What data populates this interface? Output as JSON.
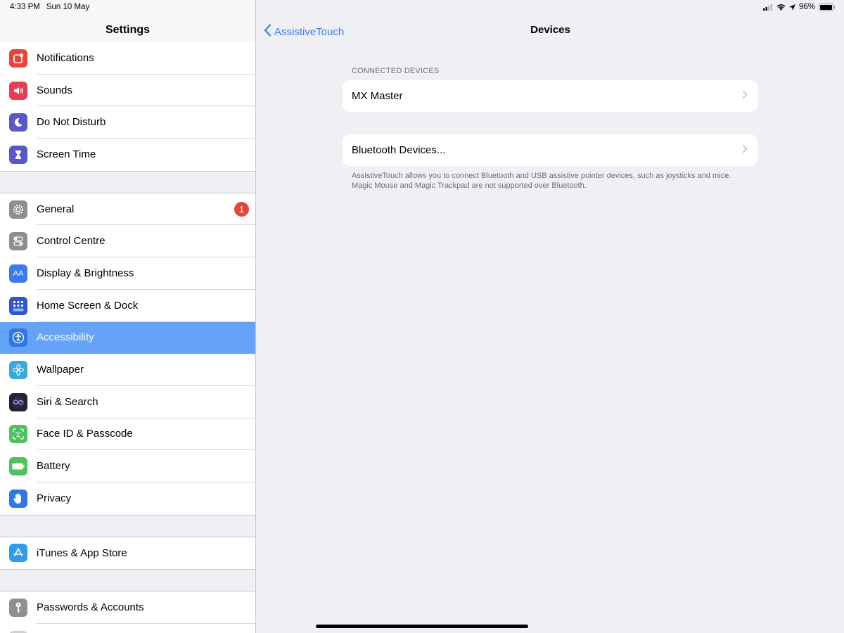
{
  "status_bar": {
    "time": "4:33 PM",
    "date": "Sun 10 May",
    "battery": "96%",
    "icons": [
      "signal-icon",
      "wifi-icon",
      "location-icon",
      "battery-icon"
    ]
  },
  "sidebar": {
    "title": "Settings",
    "groups": [
      [
        {
          "label": "Notifications",
          "icon": "notifications-icon",
          "color": "#e9433c"
        },
        {
          "label": "Sounds",
          "icon": "sounds-icon",
          "color": "#e73d54"
        },
        {
          "label": "Do Not Disturb",
          "icon": "moon-icon",
          "color": "#5a57c9"
        },
        {
          "label": "Screen Time",
          "icon": "hourglass-icon",
          "color": "#5a57c9"
        }
      ],
      [
        {
          "label": "General",
          "icon": "gear-icon",
          "color": "#8e8e93",
          "badge": "1"
        },
        {
          "label": "Control Centre",
          "icon": "toggles-icon",
          "color": "#8e8e93"
        },
        {
          "label": "Display & Brightness",
          "icon": "display-icon",
          "color": "#3a7cf0"
        },
        {
          "label": "Home Screen & Dock",
          "icon": "home-grid-icon",
          "color": "#2f56d0"
        },
        {
          "label": "Accessibility",
          "icon": "accessibility-icon",
          "color": "#2f77e8",
          "selected": true
        },
        {
          "label": "Wallpaper",
          "icon": "flower-icon",
          "color": "#37aadc"
        },
        {
          "label": "Siri & Search",
          "icon": "siri-icon",
          "color": "#222233"
        },
        {
          "label": "Face ID & Passcode",
          "icon": "faceid-icon",
          "color": "#4cc35c"
        },
        {
          "label": "Battery",
          "icon": "battery-icon",
          "color": "#4cc35c"
        },
        {
          "label": "Privacy",
          "icon": "hand-icon",
          "color": "#2f77e8"
        }
      ],
      [
        {
          "label": "iTunes & App Store",
          "icon": "appstore-icon",
          "color": "#2f9cf1"
        }
      ],
      [
        {
          "label": "Passwords & Accounts",
          "icon": "key-icon",
          "color": "#8e8e93"
        },
        {
          "label": "",
          "icon": "mail-icon",
          "color": "#cfcfd4"
        }
      ]
    ]
  },
  "main": {
    "back_label": "AssistiveTouch",
    "title": "Devices",
    "connected_header": "CONNECTED DEVICES",
    "connected_device": "MX Master",
    "bluetooth_label": "Bluetooth Devices...",
    "footer": "AssistiveTouch allows you to connect Bluetooth and USB assistive pointer devices, such as joysticks and mice. Magic Mouse and Magic Trackpad are not supported over Bluetooth."
  },
  "colors": {
    "accent": "#3a7cf0",
    "selected_row": "#65a3f8",
    "badge": "#e2443b"
  }
}
